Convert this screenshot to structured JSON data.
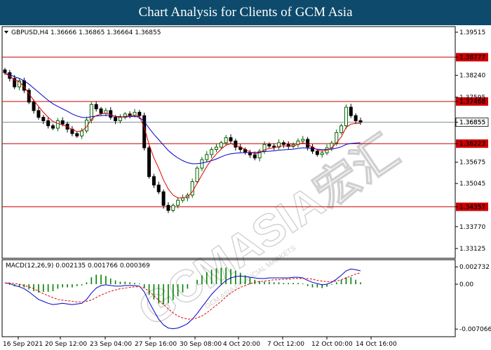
{
  "header": {
    "title": "Chart Analysis for Clients of GCM Asia"
  },
  "watermark": {
    "text": "GCMASIA宏汇",
    "subtext": "GCM ASIA FINANCIAL MARKETS"
  },
  "chart_data": {
    "type": "candlestick",
    "instrument_label": "GBPUSD,H4  1.36666 1.36865 1.36664 1.36855",
    "price_ticks": [
      "1.39515",
      "1.38777",
      "1.38240",
      "1.37595",
      "1.37468",
      "1.36855",
      "1.36223",
      "1.35675",
      "1.35045",
      "1.34357",
      "1.33770",
      "1.33125"
    ],
    "horizontal_levels": [
      {
        "value": 1.38777,
        "label": "1.38777",
        "color": "#cc0000"
      },
      {
        "value": 1.37468,
        "label": "1.37468",
        "color": "#cc0000"
      },
      {
        "value": 1.36223,
        "label": "1.36223",
        "color": "#cc0000"
      },
      {
        "value": 1.34357,
        "label": "1.34357",
        "color": "#cc0000"
      }
    ],
    "current_price": {
      "value": 1.36855,
      "label": "1.36855"
    },
    "x_ticks": [
      "16 Sep 2021",
      "20 Sep 12:00",
      "23 Sep 04:00",
      "27 Sep 16:00",
      "30 Sep 08:00",
      "4 Oct 20:00",
      "7 Oct 12:00",
      "12 Oct 00:00",
      "14 Oct 16:00"
    ],
    "close_series": [
      1.3832,
      1.3815,
      1.379,
      1.3808,
      1.378,
      1.3745,
      1.372,
      1.37,
      1.369,
      1.3675,
      1.3668,
      1.369,
      1.368,
      1.3665,
      1.3652,
      1.3645,
      1.366,
      1.3692,
      1.3738,
      1.3725,
      1.3712,
      1.372,
      1.37,
      1.369,
      1.37,
      1.371,
      1.3706,
      1.3715,
      1.3705,
      1.361,
      1.3525,
      1.35,
      1.348,
      1.344,
      1.3425,
      1.344,
      1.3455,
      1.3462,
      1.347,
      1.351,
      1.355,
      1.3575,
      1.359,
      1.3605,
      1.3612,
      1.3625,
      1.364,
      1.363,
      1.3612,
      1.3605,
      1.3596,
      1.3589,
      1.358,
      1.36,
      1.362,
      1.3615,
      1.3612,
      1.3625,
      1.362,
      1.3614,
      1.362,
      1.363,
      1.3635,
      1.3612,
      1.36,
      1.359,
      1.3595,
      1.361,
      1.3624,
      1.3655,
      1.3675,
      1.373,
      1.3705,
      1.369,
      1.3686
    ],
    "ma_fast": [
      1.383,
      1.3822,
      1.381,
      1.3805,
      1.379,
      1.377,
      1.375,
      1.3732,
      1.3715,
      1.37,
      1.3688,
      1.3682,
      1.3678,
      1.3672,
      1.3664,
      1.3658,
      1.366,
      1.3672,
      1.3695,
      1.3705,
      1.371,
      1.3712,
      1.3708,
      1.3702,
      1.37,
      1.3703,
      1.3704,
      1.3706,
      1.3702,
      1.367,
      1.362,
      1.358,
      1.355,
      1.3515,
      1.3488,
      1.347,
      1.3462,
      1.3462,
      1.3466,
      1.348,
      1.3505,
      1.353,
      1.3555,
      1.3575,
      1.3592,
      1.3606,
      1.3618,
      1.3622,
      1.3618,
      1.3612,
      1.3605,
      1.3598,
      1.3592,
      1.3595,
      1.3604,
      1.3608,
      1.361,
      1.3614,
      1.3616,
      1.3615,
      1.3616,
      1.362,
      1.3625,
      1.362,
      1.3612,
      1.3604,
      1.36,
      1.3603,
      1.361,
      1.3625,
      1.3642,
      1.367,
      1.368,
      1.3682,
      1.3682
    ],
    "ma_slow": [
      1.383,
      1.3826,
      1.382,
      1.3815,
      1.3808,
      1.3798,
      1.3786,
      1.3774,
      1.3762,
      1.375,
      1.374,
      1.3732,
      1.3725,
      1.3718,
      1.371,
      1.3704,
      1.37,
      1.3699,
      1.3702,
      1.3704,
      1.3705,
      1.3706,
      1.3705,
      1.3703,
      1.3702,
      1.3702,
      1.3702,
      1.3703,
      1.37,
      1.3688,
      1.3668,
      1.365,
      1.3634,
      1.3618,
      1.3602,
      1.359,
      1.358,
      1.3572,
      1.3566,
      1.3563,
      1.3563,
      1.3565,
      1.3568,
      1.3572,
      1.3577,
      1.3583,
      1.3589,
      1.3592,
      1.3594,
      1.3595,
      1.3596,
      1.3596,
      1.3596,
      1.3597,
      1.3599,
      1.36,
      1.3601,
      1.3603,
      1.3604,
      1.3605,
      1.3606,
      1.3608,
      1.361,
      1.3609,
      1.3608,
      1.3606,
      1.3605,
      1.3605,
      1.3606,
      1.3609,
      1.3613,
      1.362,
      1.3623,
      1.3624,
      1.3625
    ],
    "macd": {
      "label": "MACD(12,26,9) 0.002135 0.001766 0.000369",
      "ticks": [
        "0.002732",
        "0.00",
        "-0.007066"
      ],
      "zero_tick": 0,
      "min": -0.0076,
      "max": 0.0032,
      "line": [
        0.0002,
        0.0001,
        -0.0002,
        -0.0004,
        -0.0007,
        -0.0012,
        -0.0018,
        -0.0024,
        -0.0027,
        -0.003,
        -0.0032,
        -0.0031,
        -0.003,
        -0.0031,
        -0.0032,
        -0.0031,
        -0.003,
        -0.0024,
        -0.0014,
        -0.0006,
        -0.0002,
        -0.0001,
        -0.0002,
        -0.0003,
        -0.0003,
        -0.0002,
        -0.0002,
        -0.0002,
        -0.0003,
        -0.0012,
        -0.0028,
        -0.0042,
        -0.0055,
        -0.0064,
        -0.0069,
        -0.007,
        -0.0069,
        -0.0066,
        -0.0062,
        -0.0055,
        -0.0046,
        -0.0036,
        -0.0026,
        -0.0016,
        -0.0008,
        -0.0001,
        0.0006,
        0.001,
        0.0012,
        0.0013,
        0.0012,
        0.0011,
        0.001,
        0.0009,
        0.0009,
        0.001,
        0.001,
        0.001,
        0.001,
        0.001,
        0.0011,
        0.0011,
        0.001,
        0.0006,
        0.0003,
        0.0001,
        -0.0001,
        0.0,
        0.0003,
        0.0008,
        0.0014,
        0.0021,
        0.0024,
        0.0023,
        0.0021
      ],
      "signal": [
        0.0002,
        0.0002,
        0.0001,
        0.0,
        -0.0002,
        -0.0004,
        -0.0007,
        -0.0011,
        -0.0015,
        -0.0018,
        -0.0021,
        -0.0024,
        -0.0025,
        -0.0026,
        -0.0027,
        -0.0028,
        -0.0028,
        -0.0027,
        -0.0025,
        -0.0021,
        -0.0017,
        -0.0014,
        -0.0011,
        -0.0009,
        -0.0007,
        -0.0006,
        -0.0005,
        -0.0004,
        -0.0004,
        -0.0006,
        -0.0011,
        -0.0018,
        -0.0025,
        -0.0032,
        -0.0039,
        -0.0045,
        -0.005,
        -0.0053,
        -0.0055,
        -0.0055,
        -0.0053,
        -0.005,
        -0.0045,
        -0.0039,
        -0.0033,
        -0.0027,
        -0.002,
        -0.0014,
        -0.0009,
        -0.0005,
        -0.0002,
        0.0001,
        0.0003,
        0.0004,
        0.0005,
        0.0006,
        0.0007,
        0.0007,
        0.0008,
        0.0008,
        0.0009,
        0.0009,
        0.0009,
        0.0009,
        0.0008,
        0.0006,
        0.0005,
        0.0004,
        0.0004,
        0.0005,
        0.0007,
        0.001,
        0.0013,
        0.0016,
        0.0018
      ]
    },
    "colors": {
      "up": "#006400",
      "down": "#000000",
      "ma_fast": "#dd0000",
      "ma_slow": "#0000cc",
      "macd_line": "#0000cc",
      "signal_line": "#dd0000",
      "histogram": "#008000",
      "level": "#cc0000",
      "current_line": "#7b8e96"
    }
  }
}
